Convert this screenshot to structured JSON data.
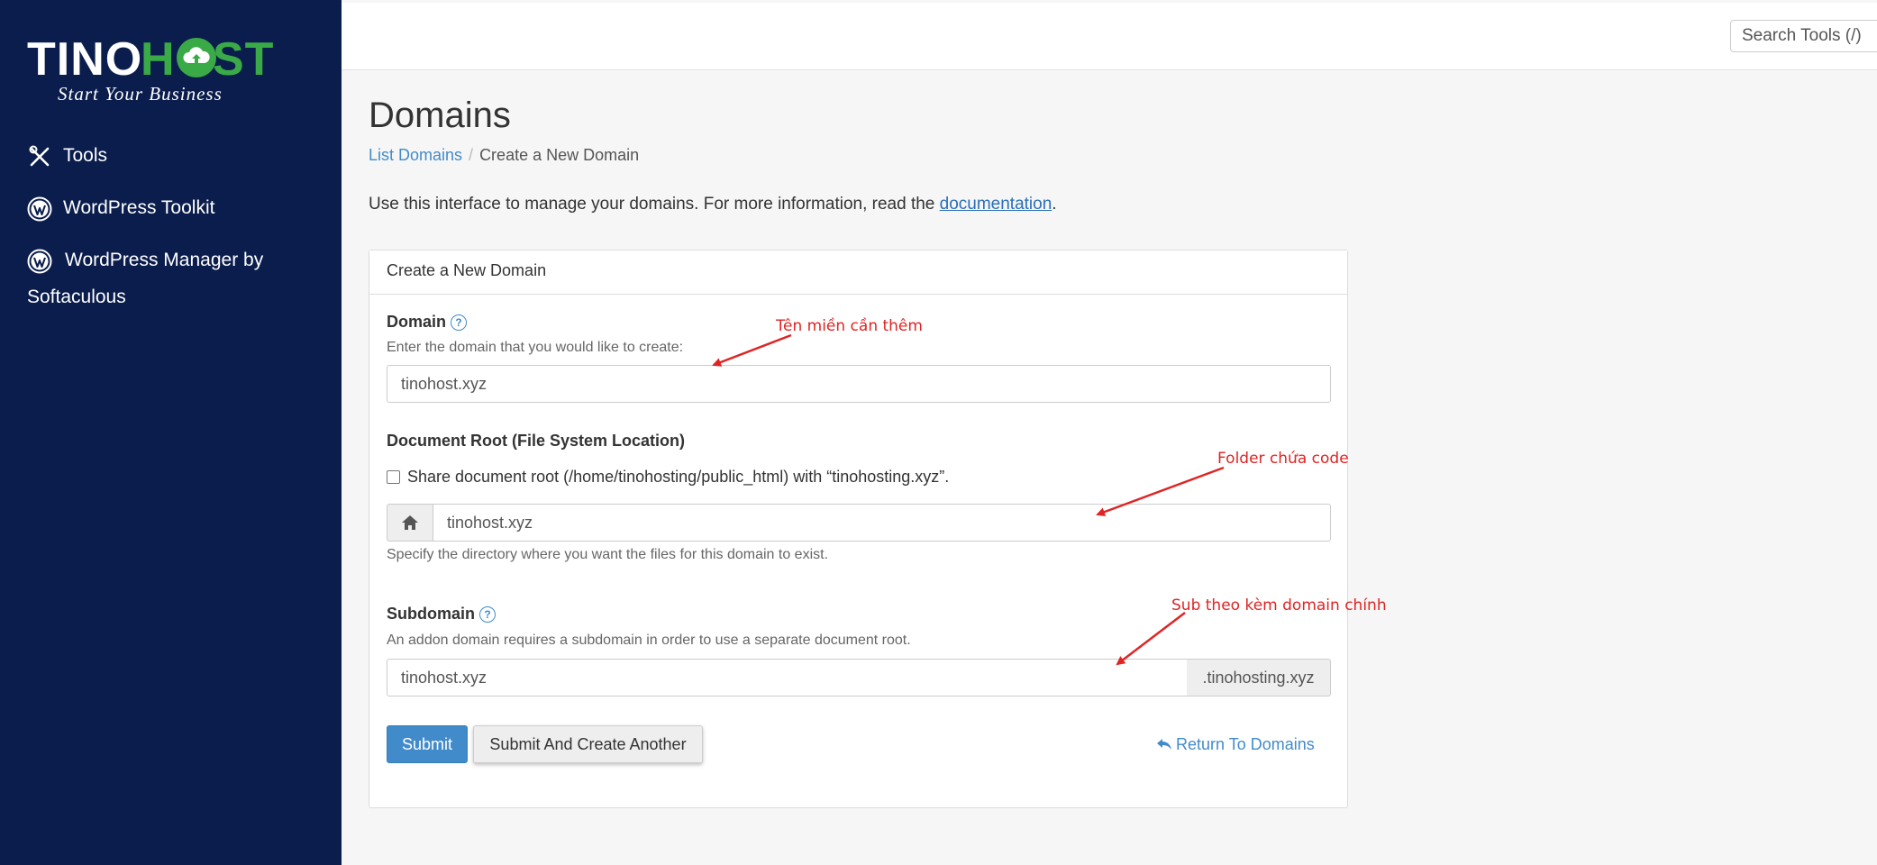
{
  "sidebar": {
    "logo": {
      "text_left": "TINO",
      "text_right": "HOST",
      "tagline": "Start Your Business"
    },
    "items": [
      {
        "label": "Tools",
        "icon": "tools-icon"
      },
      {
        "label": "WordPress Toolkit",
        "icon": "wordpress-icon"
      },
      {
        "label_line1": "WordPress Manager by",
        "label_line2": "Softaculous",
        "icon": "wordpress-icon"
      }
    ]
  },
  "topbar": {
    "search_text": "Search Tools (/)"
  },
  "page": {
    "title": "Domains",
    "breadcrumb": {
      "link": "List Domains",
      "separator": "/",
      "current": "Create a New Domain"
    },
    "intro_before": "Use this interface to manage your domains. For more information, read the ",
    "intro_link": "documentation",
    "intro_after": "."
  },
  "form": {
    "heading": "Create a New Domain",
    "domain": {
      "label": "Domain",
      "help": "Enter the domain that you would like to create:",
      "value": "tinohost.xyz"
    },
    "docroot": {
      "label": "Document Root (File System Location)",
      "share_label": "Share document root (/home/tinohosting/public_html) with “tinohosting.xyz”.",
      "share_checked": false,
      "value": "tinohost.xyz",
      "help": "Specify the directory where you want the files for this domain to exist."
    },
    "subdomain": {
      "label": "Subdomain",
      "help": "An addon domain requires a subdomain in order to use a separate document root.",
      "value": "tinohost.xyz",
      "suffix": ".tinohosting.xyz"
    },
    "buttons": {
      "submit": "Submit",
      "submit_another": "Submit And Create Another",
      "return": "Return To Domains"
    }
  },
  "annotations": {
    "domain": "Tên miền cần thêm",
    "folder": "Folder chứa code",
    "sub": "Sub theo kèm domain chính"
  },
  "colors": {
    "sidebar_bg": "#0b1d4c",
    "brand_green": "#3aaa47",
    "primary": "#428bca",
    "annotation_red": "#e02424"
  }
}
